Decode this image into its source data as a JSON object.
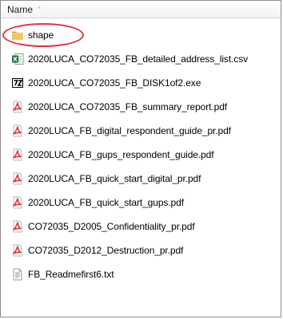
{
  "header": {
    "name_label": "Name",
    "sort_indicator": "^"
  },
  "files": [
    {
      "name": "shape",
      "icon": "folder-icon",
      "highlighted": true
    },
    {
      "name": "2020LUCA_CO72035_FB_detailed_address_list.csv",
      "icon": "excel-csv-icon"
    },
    {
      "name": "2020LUCA_CO72035_FB_DISK1of2.exe",
      "icon": "7zip-exe-icon"
    },
    {
      "name": "2020LUCA_CO72035_FB_summary_report.pdf",
      "icon": "pdf-icon"
    },
    {
      "name": "2020LUCA_FB_digital_respondent_guide_pr.pdf",
      "icon": "pdf-icon"
    },
    {
      "name": "2020LUCA_FB_gups_respondent_guide.pdf",
      "icon": "pdf-icon"
    },
    {
      "name": "2020LUCA_FB_quick_start_digital_pr.pdf",
      "icon": "pdf-icon"
    },
    {
      "name": "2020LUCA_FB_quick_start_gups.pdf",
      "icon": "pdf-icon"
    },
    {
      "name": "CO72035_D2005_Confidentiality_pr.pdf",
      "icon": "pdf-icon"
    },
    {
      "name": "CO72035_D2012_Destruction_pr.pdf",
      "icon": "pdf-icon"
    },
    {
      "name": "FB_Readmefirst6.txt",
      "icon": "text-file-icon"
    }
  ],
  "colors": {
    "highlight_ring": "#e0333c",
    "folder": "#e8b94a",
    "pdf": "#d9332b",
    "excel": "#217346"
  }
}
